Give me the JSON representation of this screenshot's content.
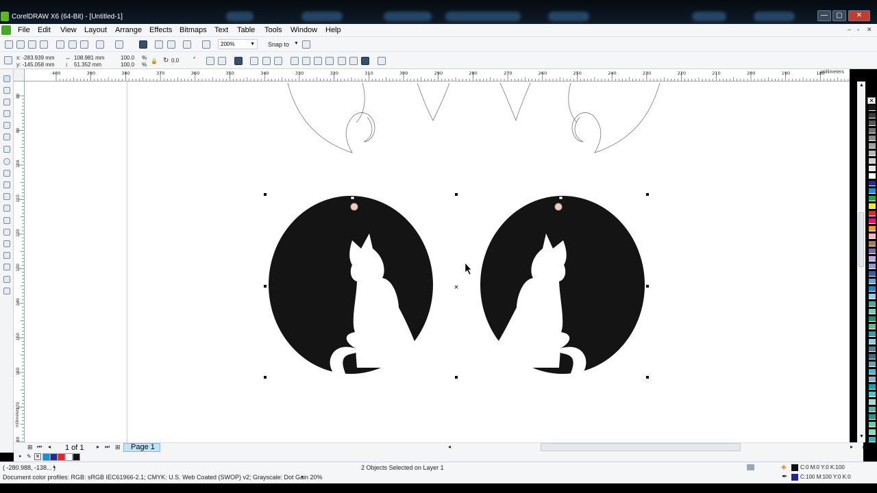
{
  "window": {
    "title": "CorelDRAW X6 (64-Bit) - [Untitled-1]"
  },
  "menu": [
    "File",
    "Edit",
    "View",
    "Layout",
    "Arrange",
    "Effects",
    "Bitmaps",
    "Text",
    "Table",
    "Tools",
    "Window",
    "Help"
  ],
  "toolbar": {
    "zoom": "200%",
    "snap_to": "Snap to"
  },
  "property_bar": {
    "x": "x: -283.939 mm",
    "y": "y: -145.058 mm",
    "width": "108.981 mm",
    "height": "51.352 mm",
    "scale_x": "100.0",
    "scale_y": "100.0",
    "percent": "%",
    "angle": "0.0",
    "angle_unit": "°"
  },
  "ruler": {
    "units": "millimeters",
    "h_ticks": [
      "400",
      "390",
      "380",
      "370",
      "360",
      "350",
      "340",
      "330",
      "320",
      "310",
      "300",
      "290",
      "280",
      "270",
      "260",
      "250",
      "240",
      "230",
      "220",
      "210",
      "200",
      "190",
      "180"
    ],
    "v_ticks": [
      "80",
      "90",
      "100",
      "110",
      "120",
      "130",
      "140",
      "150",
      "160",
      "170",
      "180"
    ],
    "v_units": "millimeters"
  },
  "pages": {
    "counter": "1 of 1",
    "tab": "Page 1"
  },
  "status": {
    "cursor": "( -280.988, -138... )",
    "selection": "2 Objects Selected on Layer 1",
    "profiles": "Document color profiles: RGB: sRGB IEC61966-2.1; CMYK: U.S. Web Coated (SWOP) v2; Grayscale: Dot Gain 20%",
    "fill": "C:0 M:0 Y:0 K:100",
    "outline": "C:100 M:100 Y:0 K:0"
  },
  "colors": {
    "accent": "#4aa52e",
    "fill_black": "#141414",
    "outline_blue": "#25238f",
    "page_tab": "#bfe3f7"
  },
  "palette": [
    "#1a1a1a",
    "#3a3a3a",
    "#555",
    "#6f6f6f",
    "#888",
    "#a0a0a0",
    "#b8b8b8",
    "#d0d0d0",
    "#e8e8e8",
    "#ffffff",
    "#1c2f8f",
    "#1a8fd8",
    "#19a84a",
    "#f3ea17",
    "#e8242a",
    "#e6137a",
    "#f59a27",
    "#f7b5c4",
    "#a87a5c",
    "#7a6a9c",
    "#b9a7d6",
    "#8a9ad6",
    "#3a5aa8",
    "#6aa0d8",
    "#2a7fc0",
    "#9ac7e8",
    "#4aa89a",
    "#7ac8b8",
    "#2a8a6a",
    "#6ab88a",
    "#3a9aa8",
    "#8ad0d8",
    "#5a7a8a",
    "#2f6f7f",
    "#6fa0a8",
    "#3fbcd0",
    "#8ab0c8",
    "#1a9ab0",
    "#48c8c8",
    "#a8d8d0",
    "#5ab0a0",
    "#2f8f8f",
    "#6acaa8",
    "#88d8c0",
    "#36b0b0"
  ],
  "doc_palette": [
    "#1a8fd8",
    "#1c2f8f",
    "#e8242a",
    "#ffffff",
    "#111111"
  ]
}
